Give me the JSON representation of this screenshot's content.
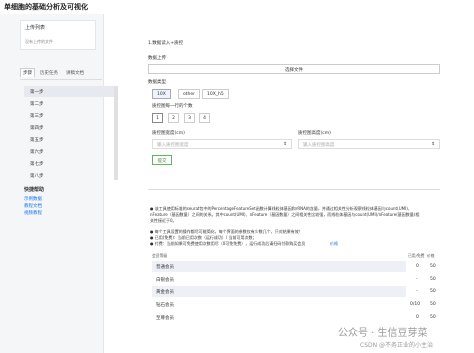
{
  "window": {
    "title": "单细胞的基础分析及可视化"
  },
  "sidebar": {
    "upload_card": {
      "title": "上传列表",
      "empty": "没有上传的文件"
    },
    "tabs": [
      "步骤",
      "历史任务",
      "讲稿文档"
    ],
    "steps": [
      "第一步",
      "第二步",
      "第三步",
      "第四步",
      "第五步",
      "第六步",
      "第七步",
      "第八步"
    ],
    "help": {
      "title": "快捷帮助",
      "links": [
        "示例数据",
        "教程文档",
        "视频教程"
      ]
    }
  },
  "main": {
    "section_title": "1.数据读入+质控",
    "upload_label": "数据上传",
    "file_button": "选择文件",
    "type_label": "数据类型",
    "type_options": [
      "10X",
      "other",
      "10X_h5"
    ],
    "type_selected": "10X",
    "sample_label": "质控图每一行的个数",
    "sample_options": [
      "1",
      "2",
      "3",
      "4"
    ],
    "sample_selected": "1",
    "width_label": "质控图宽度(cm)",
    "width_placeholder": "输入质控图宽度",
    "height_label": "质控图高度(cm)",
    "height_placeholder": "输入质控图高度",
    "submit_label": "提交",
    "desc": [
      "● 该工具使用标准的seurat包中的PercentageFeatureSet函数计算线粒体基因和rRNA的含量，并通过相关性分析观察线粒体基因与count(UMI)、nFeature（基因数量）之间的关系。其中count(UMI)、nFeature（基因数量）之间相关性比较强，而线粒体基因与count(UMI)/nFeature(基因数量)相关性接近于0。",
      "● 每个工具设置的操作都尽可能简化，每个界面的参数仅有少数几个，只对结果有效！",
      "● 已用(免费)：当前已用次数（运行成功）/ 当前可用次数；",
      "● 付费：当前如果可免费使用次数用尽（0可免免费），运行成功后请扫码付款购买会员"
    ],
    "desc_link": "价格"
  },
  "table": {
    "headers": {
      "member": "会员等级",
      "used": "已用/免费",
      "price": "价格"
    },
    "rows": [
      {
        "name": "普通会员",
        "used": "0",
        "price": "50"
      },
      {
        "name": "白银会员",
        "used": "-",
        "price": "50"
      },
      {
        "name": "黄金会员",
        "used": "-",
        "price": "50"
      },
      {
        "name": "钻石会员",
        "used": "0/10",
        "price": "50"
      },
      {
        "name": "至尊会员",
        "used": "0",
        "price": "50"
      }
    ]
  },
  "watermark": {
    "line1": "公众号 · 生信豆芽菜",
    "line2": "CSDN @不务正业的小主治"
  }
}
